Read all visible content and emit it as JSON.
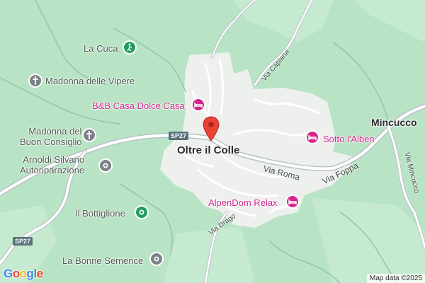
{
  "map": {
    "town": "Oltre il Colle",
    "places": {
      "la_cuca": "La Cuca",
      "madonna_vipere": "Madonna delle Vipere",
      "madonna_buon_consiglio_l1": "Madonna del",
      "madonna_buon_consiglio_l2": "Buon Consiglio",
      "arnoldi_l1": "Arnoldi Silvano",
      "arnoldi_l2": "Autoriparazione",
      "bottiglione": "Il Bottiglione",
      "bonne_semence": "La Bonne Semence",
      "mincucco": "Mincucco"
    },
    "hotels": {
      "bb_casa": "B&B Casa Dolce Casa",
      "sotto_alben": "Sotto l'Alben",
      "alpendom": "AlpenDom Relax"
    },
    "streets": {
      "via_roma": "Via Roma",
      "via_foppa": "Via Foppa",
      "via_capiana": "Via Capiana",
      "via_drago": "Via Drago",
      "via_mincucco": "Via Mincucco"
    },
    "road_shields": {
      "sp27_top": "SP27",
      "sp27_left": "SP27"
    },
    "icons": {
      "la_cuca": "hiking-icon",
      "madonna_vipere": "church-icon",
      "madonna_buon_consiglio": "church-icon",
      "arnoldi": "service-pin-icon",
      "bottiglione": "park-icon",
      "bonne_semence": "place-icon",
      "hotel": "bed-icon",
      "marker": "location-pin-icon"
    },
    "colors": {
      "terrain": "#b9e3c5",
      "settlement": "#eef0ee",
      "hotel": "#d3288f",
      "park": "#1f9e5a",
      "marker": "#ea4335"
    }
  },
  "branding": {
    "logo": "Google",
    "attribution": "Map data ©2025"
  }
}
